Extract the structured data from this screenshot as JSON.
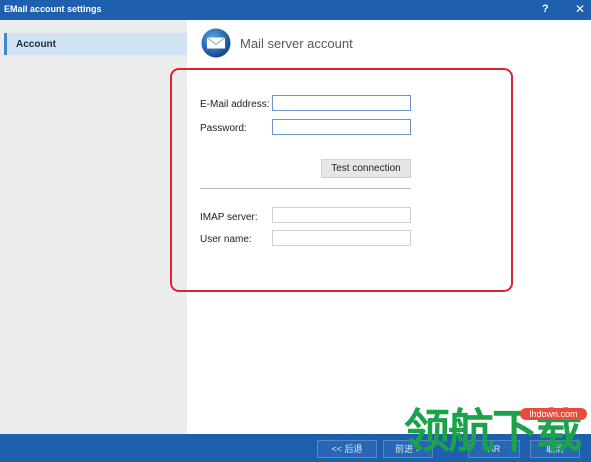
{
  "window": {
    "title": "EMail account settings",
    "help_label": "?",
    "close_label": "✕"
  },
  "sidebar": {
    "items": [
      {
        "label": "Account"
      }
    ]
  },
  "page": {
    "title": "Mail server account",
    "icon": "mail-envelope-icon"
  },
  "form": {
    "email_label": "E-Mail address:",
    "email_value": "",
    "password_label": "Password:",
    "password_value": "",
    "test_button": "Test connection",
    "imap_label": "IMAP server:",
    "imap_value": "",
    "username_label": "User name:",
    "username_value": ""
  },
  "footer": {
    "back": "<< 后退",
    "next": "前进 >",
    "finish": "AR",
    "cancel": "取消"
  },
  "watermark": {
    "domain": "lhdown.com",
    "text": "领航下载"
  },
  "colors": {
    "titlebar": "#1e5fae",
    "highlight": "#d9262c",
    "sidebar_selected": "#cfe3f5",
    "watermark": "#1aa34a"
  }
}
